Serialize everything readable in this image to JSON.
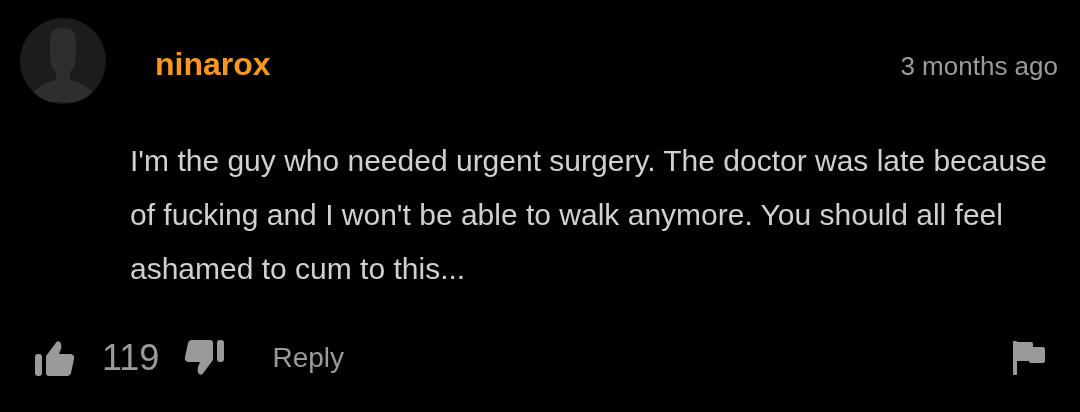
{
  "comment": {
    "username": "ninarox",
    "time": "3 months ago",
    "text": "I'm the guy who needed urgent surgery. The doctor was late because of fucking and I won't be able to walk anymore. You should all feel ashamed to cum to this...",
    "likes": "119",
    "reply": "Reply"
  }
}
